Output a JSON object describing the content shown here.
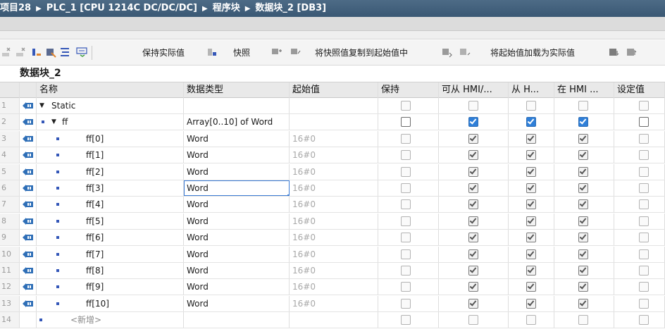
{
  "breadcrumb": {
    "project": "项目28",
    "plc": "PLC_1 [CPU 1214C DC/DC/DC]",
    "blocks": "程序块",
    "db": "数据块_2 [DB3]"
  },
  "toolbar": {
    "keep_actual": "保持实际值",
    "snapshot": "快照",
    "copy_snapshot": "将快照值复制到起始值中",
    "load_start": "将起始值加载为实际值"
  },
  "db_name": "数据块_2",
  "columns": {
    "name": "名称",
    "datatype": "数据类型",
    "start": "起始值",
    "retain": "保持",
    "hmi_access": "可从 HMI/...",
    "hmi_visible": "从 H...",
    "hmi_in": "在 HMI ...",
    "setpoint": "设定值"
  },
  "rows": [
    {
      "num": "1",
      "name": "Static",
      "type": "",
      "start": ""
    },
    {
      "num": "2",
      "name": "ff",
      "type": "Array[0..10] of Word",
      "start": ""
    },
    {
      "num": "3",
      "name": "ff[0]",
      "type": "Word",
      "start": "16#0"
    },
    {
      "num": "4",
      "name": "ff[1]",
      "type": "Word",
      "start": "16#0"
    },
    {
      "num": "5",
      "name": "ff[2]",
      "type": "Word",
      "start": "16#0"
    },
    {
      "num": "6",
      "name": "ff[3]",
      "type": "Word",
      "start": "16#0"
    },
    {
      "num": "7",
      "name": "ff[4]",
      "type": "Word",
      "start": "16#0"
    },
    {
      "num": "8",
      "name": "ff[5]",
      "type": "Word",
      "start": "16#0"
    },
    {
      "num": "9",
      "name": "ff[6]",
      "type": "Word",
      "start": "16#0"
    },
    {
      "num": "10",
      "name": "ff[7]",
      "type": "Word",
      "start": "16#0"
    },
    {
      "num": "11",
      "name": "ff[8]",
      "type": "Word",
      "start": "16#0"
    },
    {
      "num": "12",
      "name": "ff[9]",
      "type": "Word",
      "start": "16#0"
    },
    {
      "num": "13",
      "name": "ff[10]",
      "type": "Word",
      "start": "16#0"
    },
    {
      "num": "14",
      "name": "<新增>",
      "type": "",
      "start": ""
    }
  ],
  "colors": {
    "title_bg": "#3f5d79",
    "selection": "#3b7bd4",
    "checkbox_blue": "#2f7fd8"
  }
}
